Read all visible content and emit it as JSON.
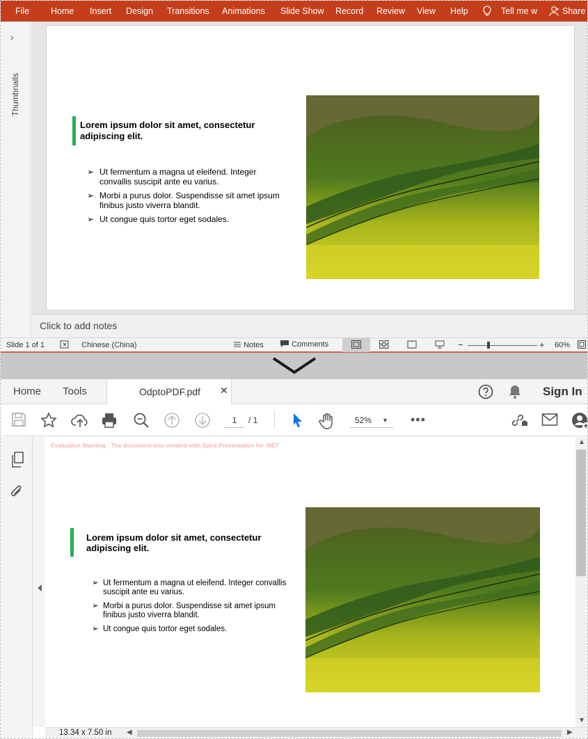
{
  "ppt": {
    "ribbon_tabs": [
      "File",
      "Home",
      "Insert",
      "Design",
      "Transitions",
      "Animations",
      "Slide Show",
      "Record",
      "Review",
      "View",
      "Help"
    ],
    "tell_me": "Tell me w",
    "share": "Share",
    "thumbnails_label": "Thumbnails",
    "notes_placeholder": "Click to add notes",
    "status": {
      "slide_info": "Slide 1 of 1",
      "language": "Chinese (China)",
      "notes": "Notes",
      "comments": "Comments",
      "zoom": "60%",
      "zoom_level": 0.3
    }
  },
  "slide": {
    "title": "Lorem ipsum dolor sit amet, consectetur adipiscing elit.",
    "bullets": [
      "Ut fermentum a magna ut eleifend. Integer convallis suscipit ante eu varius.",
      "Morbi a purus dolor. Suspendisse sit amet ipsum finibus justo viverra blandit.",
      "Ut congue quis tortor eget sodales."
    ],
    "accent_color": "#21b15a"
  },
  "acrobat": {
    "tabs": {
      "home": "Home",
      "tools": "Tools",
      "document": "OdptoPDF.pdf"
    },
    "sign_in": "Sign In",
    "page_current": "1",
    "page_total": "/ 1",
    "zoom": "52%",
    "evaluation_warning": "Evaluation Warning : The document was created with  Spire.Presentation for .NET",
    "page_size": "13.34 x 7.50 in"
  },
  "colors": {
    "ppt_ribbon": "#c43e1c",
    "acrobat_select": "#1473e6"
  }
}
